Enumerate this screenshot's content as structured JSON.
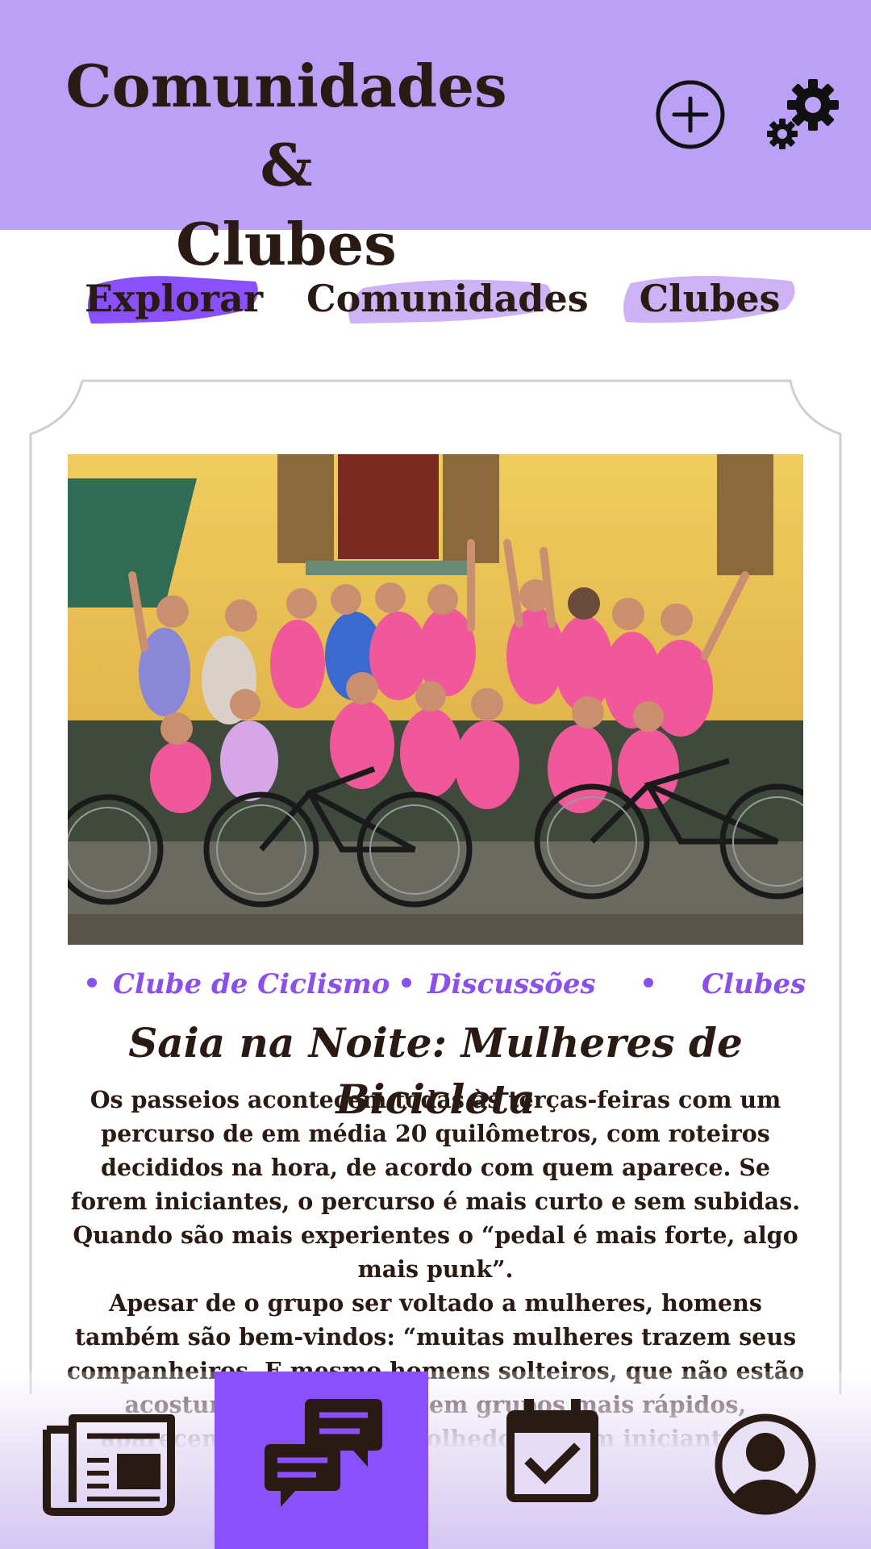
{
  "header": {
    "title_line1": "Comunidades &",
    "title_line2": "Clubes",
    "icons": [
      "add-circle-icon",
      "gears-icon"
    ]
  },
  "tabs": [
    {
      "label": "Explorar",
      "selected": true
    },
    {
      "label": "Comunidades",
      "selected": false
    },
    {
      "label": "Clubes",
      "selected": false
    }
  ],
  "card": {
    "tags": [
      "Clube de Ciclismo",
      "Discussões",
      "Clubes"
    ],
    "title": "Saia na Noite: Mulheres de Bicicleta",
    "paragraph1": "Os passeios acontecem todas às terças-feiras com um percurso de em média 20 quilômetros, com roteiros decididos na hora, de acordo com quem aparece. Se forem iniciantes, o percurso é mais curto e sem subidas. Quando são mais experientes o “pedal é mais forte, algo mais punk”.",
    "paragraph2": "Apesar de o grupo ser voltado a mulheres, homens também são bem-vindos: “muitas mulheres trazem seus companheiros. E mesmo homens solteiros, que não estão acostumados a pedalar em grupos mais rápidos, aparecem. Somos bem acolhedoras com iniciantes”."
  },
  "bottom_nav": {
    "items": [
      {
        "icon": "newspaper-icon",
        "active": false
      },
      {
        "icon": "chat-bubbles-icon",
        "active": true
      },
      {
        "icon": "calendar-check-icon",
        "active": false
      },
      {
        "icon": "profile-icon",
        "active": false
      }
    ]
  },
  "colors": {
    "header_bg": "#bba1f5",
    "accent": "#8a50fb",
    "tab_brush_light": "#cdb2f5",
    "text_dark": "#2a1a14"
  }
}
